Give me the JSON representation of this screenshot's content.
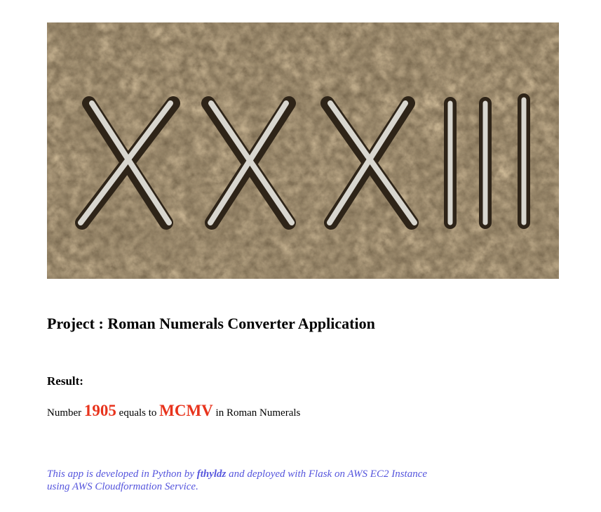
{
  "hero_image": {
    "alt": "XXXIII"
  },
  "title": "Project : Roman Numerals Converter Application",
  "result": {
    "label": "Result:",
    "prefix": "Number",
    "number": "1905",
    "middle": "equals to",
    "roman": "MCMV",
    "suffix": "in Roman Numerals"
  },
  "footer": {
    "part1": "This app is developed in Python by",
    "author": "fthyldz",
    "part2": "and deployed with Flask on AWS EC2 Instance",
    "part3": "using AWS Cloudformation Service."
  },
  "colors": {
    "accent": "#e8331c",
    "footer": "#5555dd"
  }
}
